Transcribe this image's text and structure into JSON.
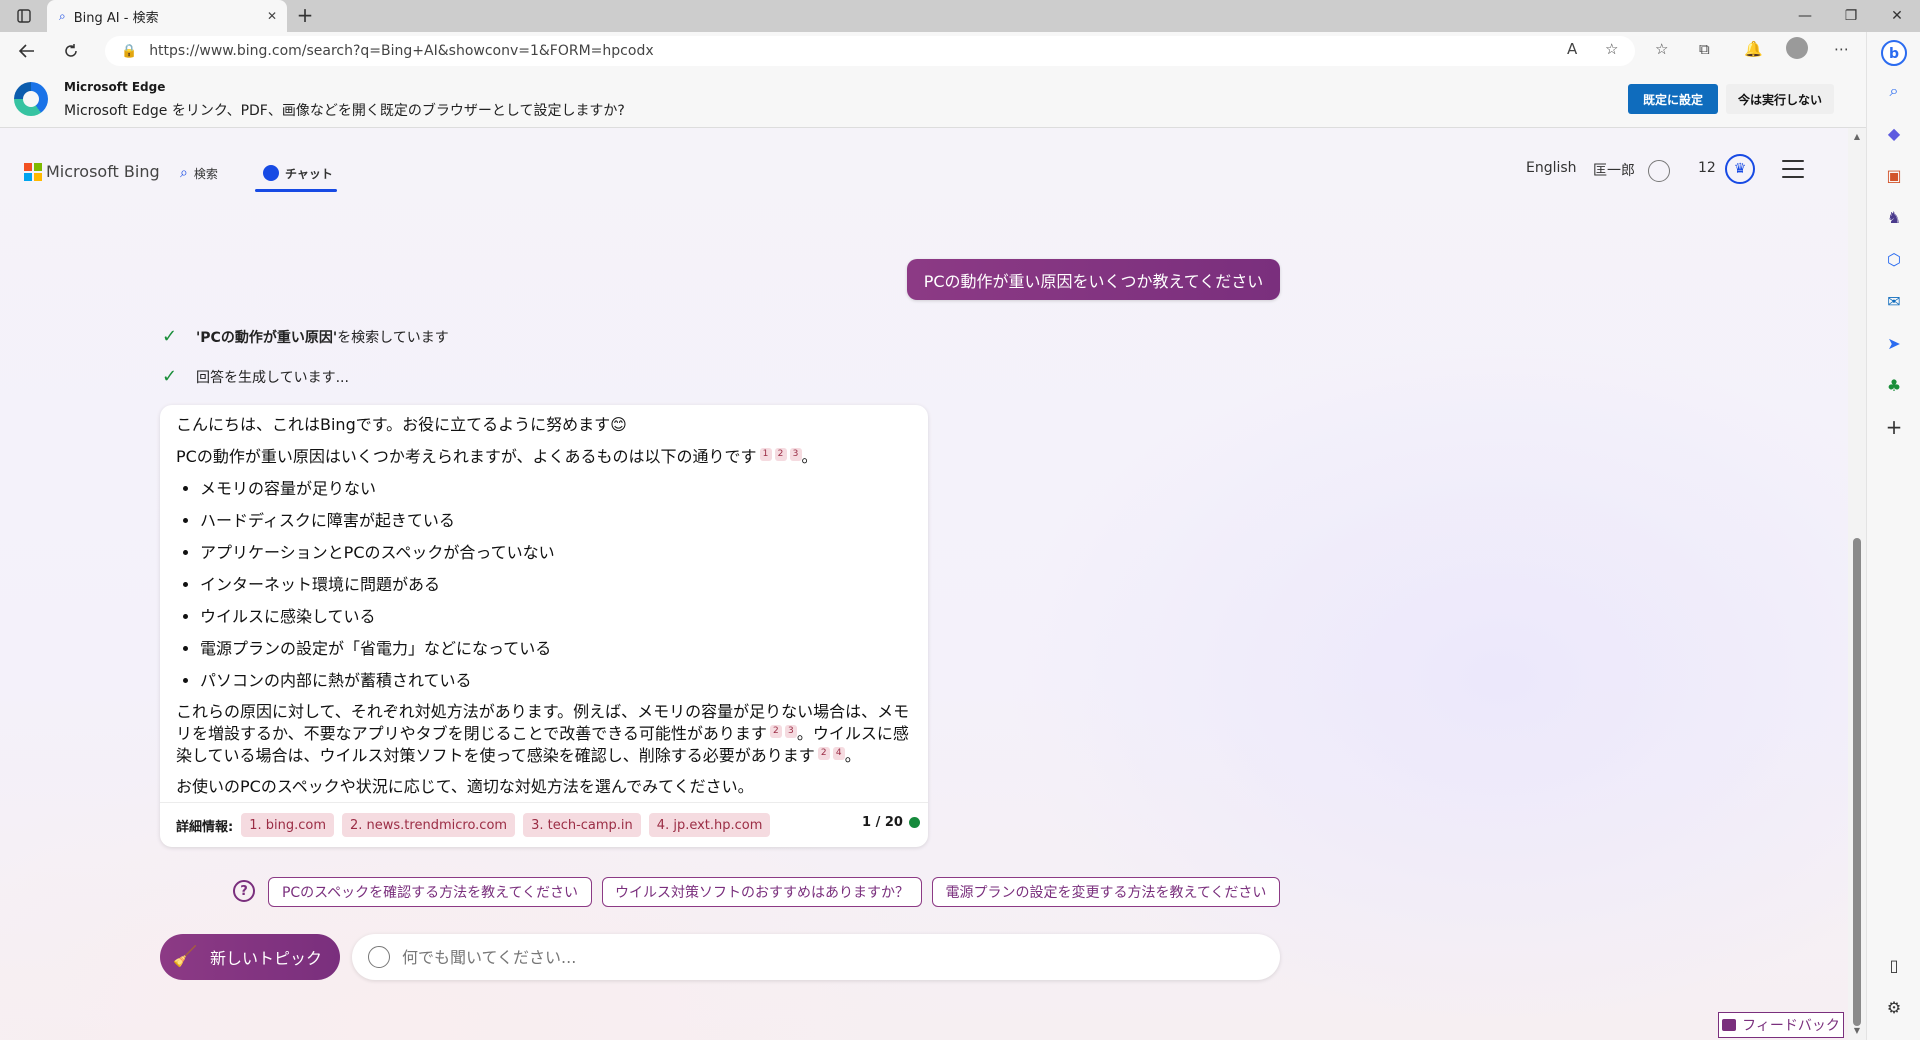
{
  "browser": {
    "tab_title": "Bing AI - 検索",
    "tab_close": "✕",
    "new_tab": "+",
    "url": "https://www.bing.com/search?q=Bing+AI&showconv=1&FORM=hpcodx",
    "window": {
      "minimize": "—",
      "restore": "❐",
      "close": "✕"
    }
  },
  "infobar": {
    "title": "Microsoft Edge",
    "message": "Microsoft Edge をリンク、PDF、画像などを開く既定のブラウザーとして設定しますか?",
    "primary_button": "既定に設定",
    "secondary_button": "今は実行しない"
  },
  "header": {
    "logo_text": "Microsoft Bing",
    "nav_search": "検索",
    "nav_chat": "チャット",
    "language": "English",
    "user_name": "匡一郎",
    "points": "12"
  },
  "chat": {
    "user_message": "PCの動作が重い原因をいくつか教えてください",
    "status_search_term": "'PCの動作が重い原因'",
    "status_search_suffix": " を検索しています",
    "status_generating": "回答を生成しています...",
    "answer": {
      "greeting": "こんにちは、これはBingです。お役に立てるように努めます😊",
      "intro": "PCの動作が重い原因はいくつか考えられますが、よくあるものは以下の通りです",
      "intro_end": "。",
      "intro_cites": [
        "1",
        "2",
        "3"
      ],
      "list": [
        "メモリの容量が足りない",
        "ハードディスクに障害が起きている",
        "アプリケーションとPCのスペックが合っていない",
        "インターネット環境に問題がある",
        "ウイルスに感染している",
        "電源プランの設定が「省電力」などになっている",
        "パソコンの内部に熱が蓄積されている"
      ],
      "p3_part1": "これらの原因に対して、それぞれ対処方法があります。例えば、メモリの容量が足りない場合は、メモリを増設するか、不要なアプリやタブを閉じることで改善できる可能性があります",
      "p3_cites1": [
        "2",
        "3"
      ],
      "p3_part2": "。ウイルスに感染している場合は、ウイルス対策ソフトを使って感染を確認し、削除する必要があります",
      "p3_cites2": [
        "2",
        "4"
      ],
      "p3_end": "。",
      "closing": "お使いのPCのスペックや状況に応じて、適切な対処方法を選んでみてください。"
    },
    "sources_label": "詳細情報:",
    "sources": [
      "1. bing.com",
      "2. news.trendmicro.com",
      "3. tech-camp.in",
      "4. jp.ext.hp.com"
    ],
    "turn_counter": "1 / 20",
    "suggestions": [
      "PCのスペックを確認する方法を教えてください",
      "ウイルス対策ソフトのおすすめはありますか？",
      "電源プランの設定を変更する方法を教えてください"
    ],
    "new_topic_label": "新しいトピック",
    "input_placeholder": "何でも聞いてください..."
  },
  "feedback_label": "フィードバック",
  "colors": {
    "accent": "#7a2f7d",
    "bing_blue": "#174ae4",
    "edge_blue": "#0f6cbd",
    "check_green": "#1a8e3a"
  },
  "icons": {
    "tab_actions": "tab-actions-icon",
    "back": "back-icon",
    "refresh": "refresh-icon",
    "info": "site-info-icon",
    "read_aloud": "read-aloud-icon",
    "add_favorite": "add-favorite-icon",
    "favorites": "favorites-icon",
    "collections": "collections-icon",
    "notifications": "notifications-icon",
    "profile": "profile-icon",
    "more": "more-icon",
    "bing_chat": "bing-chat-icon"
  }
}
